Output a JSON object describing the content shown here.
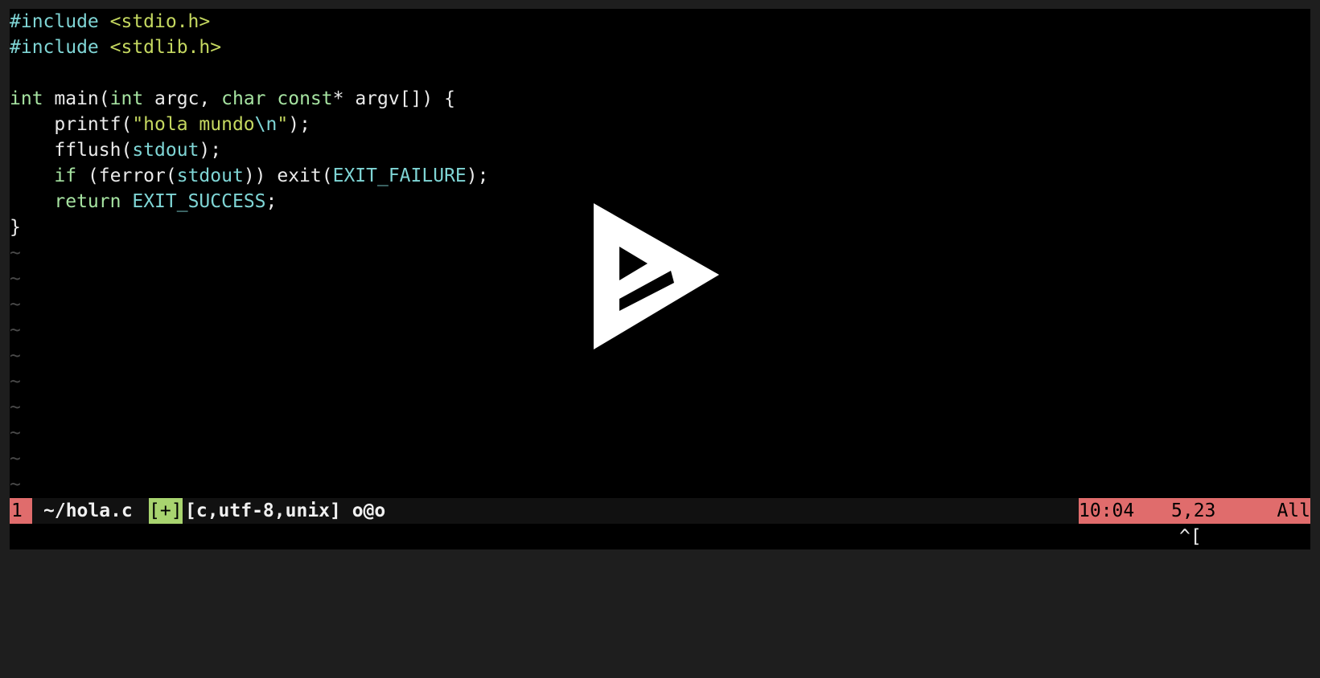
{
  "editor": {
    "lines": [
      [
        {
          "t": "#include ",
          "c": "pp"
        },
        {
          "t": "<stdio.h>",
          "c": "str"
        }
      ],
      [
        {
          "t": "#include ",
          "c": "pp"
        },
        {
          "t": "<stdlib.h>",
          "c": "str"
        }
      ],
      [],
      [
        {
          "t": "int",
          "c": "kw"
        },
        {
          "t": " main(",
          "c": ""
        },
        {
          "t": "int",
          "c": "kw"
        },
        {
          "t": " argc, ",
          "c": ""
        },
        {
          "t": "char",
          "c": "kw"
        },
        {
          "t": " ",
          "c": ""
        },
        {
          "t": "const",
          "c": "kw"
        },
        {
          "t": "* argv[]) {",
          "c": ""
        }
      ],
      [
        {
          "t": "    printf(",
          "c": ""
        },
        {
          "t": "\"hola mundo",
          "c": "str"
        },
        {
          "t": "\\n",
          "c": "cst"
        },
        {
          "t": "\"",
          "c": "str"
        },
        {
          "t": ");",
          "c": ""
        }
      ],
      [
        {
          "t": "    fflush(",
          "c": ""
        },
        {
          "t": "stdout",
          "c": "cst"
        },
        {
          "t": ");",
          "c": ""
        }
      ],
      [
        {
          "t": "    ",
          "c": ""
        },
        {
          "t": "if",
          "c": "kw"
        },
        {
          "t": " (ferror(",
          "c": ""
        },
        {
          "t": "stdout",
          "c": "cst"
        },
        {
          "t": ")) exit(",
          "c": ""
        },
        {
          "t": "EXIT_FAILURE",
          "c": "cst"
        },
        {
          "t": ");",
          "c": ""
        }
      ],
      [
        {
          "t": "    ",
          "c": ""
        },
        {
          "t": "return",
          "c": "kw"
        },
        {
          "t": " ",
          "c": ""
        },
        {
          "t": "EXIT_SUCCESS",
          "c": "cst"
        },
        {
          "t": ";",
          "c": ""
        }
      ],
      [
        {
          "t": "}",
          "c": ""
        }
      ]
    ],
    "tilde": "~",
    "tilde_count": 10
  },
  "statusline": {
    "buffer_number": "1",
    "file_path": "~/hola.c",
    "modified_flag": "[+]",
    "file_info": "[c,utf-8,unix] o@o",
    "time": "10:04",
    "position": "5,23",
    "scroll": "All"
  },
  "command_line": {
    "text": "^["
  },
  "overlay": {
    "play_icon": "asciinema-play-icon"
  },
  "colors": {
    "background": "#000000",
    "keyword": "#a6e3a1",
    "preprocessor": "#7fd5d5",
    "string": "#c5d860",
    "status_accent": "#e06c6c",
    "modified_badge": "#a8d46f"
  }
}
